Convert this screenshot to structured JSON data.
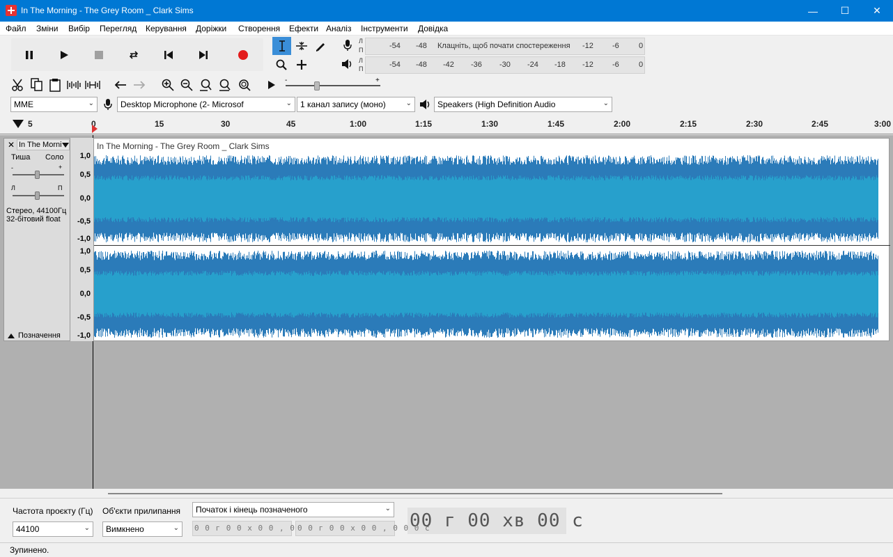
{
  "window": {
    "title": "In The Morning - The Grey Room _ Clark Sims",
    "min": "—",
    "max": "☐",
    "close": "✕"
  },
  "menu": [
    "Файл",
    "Зміни",
    "Вибір",
    "Перегляд",
    "Керування",
    "Доріжки",
    "Створення",
    "Ефекти",
    "Аналіз",
    "Інструменти",
    "Довідка"
  ],
  "meters": {
    "record": {
      "lr_top": "Л",
      "lr_bottom": "П",
      "hint": "Клацніть, щоб почати спостереження",
      "ticks": [
        "-54",
        "-48",
        "-12",
        "-6",
        "0"
      ]
    },
    "playback": {
      "lr_top": "Л",
      "lr_bottom": "П",
      "ticks": [
        "-54",
        "-48",
        "-42",
        "-36",
        "-30",
        "-24",
        "-18",
        "-12",
        "-6",
        "0"
      ]
    }
  },
  "playspeed": {
    "minus": "-",
    "plus": "+"
  },
  "devices": {
    "host": "MME",
    "input": "Desktop Microphone (2- Microsof",
    "channels": "1 канал запису (моно)",
    "output": "Speakers (High Definition Audio"
  },
  "ruler": {
    "start": "5",
    "ticks": [
      "0",
      "15",
      "30",
      "45",
      "1:00",
      "1:15",
      "1:30",
      "1:45",
      "2:00",
      "2:15",
      "2:30",
      "2:45",
      "3:00"
    ]
  },
  "track": {
    "name": "In The Morni",
    "close": "✕",
    "mute": "Тиша",
    "solo": "Соло",
    "gain_minus": "-",
    "gain_plus": "+",
    "pan_left": "Л",
    "pan_right": "П",
    "format_rate": "Стерео, 44100Гц",
    "format_bits": "32-бітовий float",
    "select_label": "Позначення",
    "clip_name": "In The Morning - The Grey Room _ Clark Sims",
    "scale": [
      "1,0",
      "0,5",
      "0,0",
      "-0,5",
      "-1,0"
    ]
  },
  "colors": {
    "wave_dark": "#2b7bb9",
    "wave_light": "#27a0cc",
    "record": "#e31b1b",
    "titlebar": "#0078d4"
  },
  "bottom": {
    "rate_label": "Частота проєкту (Гц)",
    "rate_value": "44100",
    "snap_label": "Об'єкти прилипання",
    "snap_value": "Вимкнено",
    "selection_mode": "Початок і кінець позначеного",
    "sel_start": "0 0 г 0 0 х 0 0 , 0 0 0 с",
    "sel_end": "0 0 г 0 0 х 0 0 , 0 0 0 с",
    "time": "00 г 00 хв 00 с"
  },
  "status": "Зупинено."
}
